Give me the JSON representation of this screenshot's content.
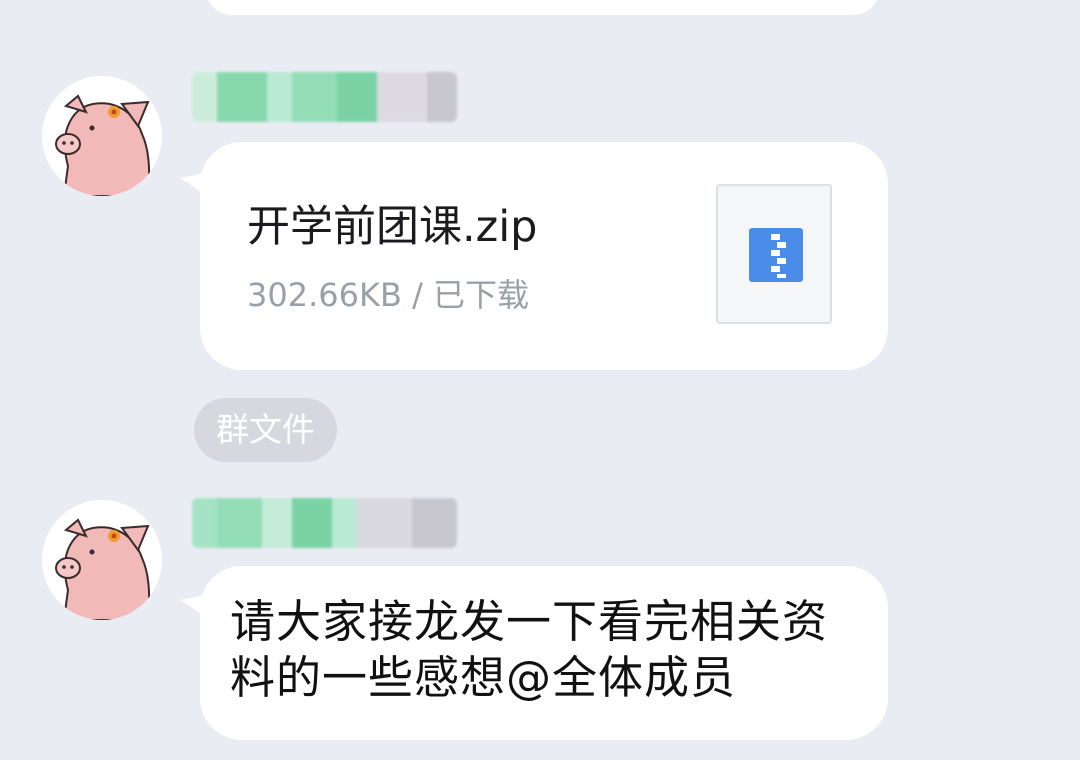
{
  "messages": [
    {
      "type": "file",
      "file_name": "开学前团课.zip",
      "file_meta": "302.66KB / 已下载",
      "file_icon": "zip-file-icon",
      "tag": "群文件"
    },
    {
      "type": "text",
      "text": "请大家接龙发一下看完相关资料的一些感想@全体成员"
    }
  ],
  "theme": {
    "background": "#eaecf3",
    "bubble": "#ffffff",
    "zip_icon_color": "#4a8de8",
    "tag_background": "#d6d8de"
  }
}
